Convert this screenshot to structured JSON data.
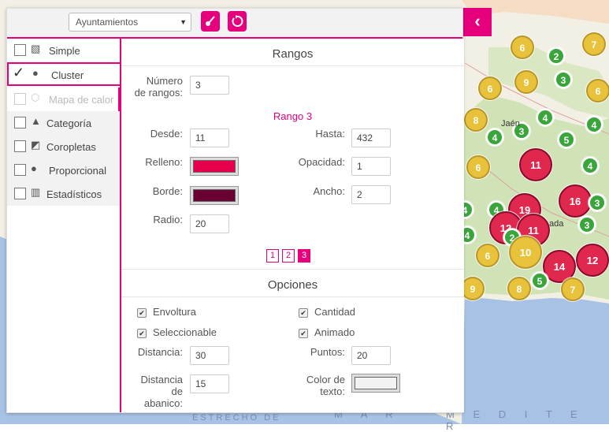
{
  "map": {
    "city_labels": [
      "Jaén",
      "ada"
    ],
    "sea_labels": [
      "ESTRECHO DE",
      "M A R",
      "M E D I T E R"
    ],
    "clusters": [
      {
        "count": "6",
        "color": "#e8c23a"
      },
      {
        "count": "7",
        "color": "#e8c23a"
      },
      {
        "count": "2",
        "color": "#3aa53a"
      },
      {
        "count": "9",
        "color": "#e8c23a"
      },
      {
        "count": "3",
        "color": "#3aa53a"
      },
      {
        "count": "6",
        "color": "#e8c23a"
      },
      {
        "count": "6",
        "color": "#e8c23a"
      },
      {
        "count": "8",
        "color": "#e8c23a"
      },
      {
        "count": "4",
        "color": "#3aa53a"
      },
      {
        "count": "3",
        "color": "#3aa53a"
      },
      {
        "count": "4",
        "color": "#3aa53a"
      },
      {
        "count": "4",
        "color": "#3aa53a"
      },
      {
        "count": "5",
        "color": "#3aa53a"
      },
      {
        "count": "6",
        "color": "#e8c23a"
      },
      {
        "count": "11",
        "color": "#e0284f"
      },
      {
        "count": "4",
        "color": "#3aa53a"
      },
      {
        "count": "16",
        "color": "#e0284f"
      },
      {
        "count": "3",
        "color": "#3aa53a"
      },
      {
        "count": "4",
        "color": "#3aa53a"
      },
      {
        "count": "19",
        "color": "#e0284f"
      },
      {
        "count": "12",
        "color": "#e0284f"
      },
      {
        "count": "11",
        "color": "#e0284f"
      },
      {
        "count": "2",
        "color": "#3aa53a"
      },
      {
        "count": "4",
        "color": "#3aa53a"
      },
      {
        "count": "3",
        "color": "#3aa53a"
      },
      {
        "count": "10",
        "color": "#e8c23a"
      },
      {
        "count": "6",
        "color": "#e8c23a"
      },
      {
        "count": "12",
        "color": "#e0284f"
      },
      {
        "count": "14",
        "color": "#e0284f"
      },
      {
        "count": "5",
        "color": "#3aa53a"
      },
      {
        "count": "9",
        "color": "#e8c23a"
      },
      {
        "count": "8",
        "color": "#e8c23a"
      },
      {
        "count": "7",
        "color": "#e8c23a"
      },
      {
        "count": "4",
        "color": "#3aa53a"
      }
    ]
  },
  "toolbar": {
    "layer_value": "Ayuntamientos",
    "style_icon": "paint-brush-icon",
    "reset_icon": "refresh-icon",
    "collapse_icon": "chevron-left-icon"
  },
  "sidebar": {
    "items": [
      {
        "label": "Simple",
        "icon": "simple-style-icon"
      },
      {
        "label": "Cluster",
        "icon": "cluster-icon"
      },
      {
        "label": "Mapa de calor",
        "icon": "heatmap-icon"
      },
      {
        "label": "Categoría",
        "icon": "category-icon"
      },
      {
        "label": "Coropletas",
        "icon": "choropleth-icon"
      },
      {
        "label": "Proporcional",
        "icon": "proportional-icon"
      },
      {
        "label": "Estadísticos",
        "icon": "statistics-icon"
      }
    ]
  },
  "rangos": {
    "title": "Rangos",
    "num_label_1": "Número",
    "num_label_2": "de rangos:",
    "num_value": "3",
    "range_title": "Rango 3",
    "desde_label": "Desde:",
    "desde_value": "11",
    "hasta_label": "Hasta:",
    "hasta_value": "432",
    "relleno_label": "Relleno:",
    "relleno_color": "#e6004c",
    "opacidad_label": "Opacidad:",
    "opacidad_value": "1",
    "borde_label": "Borde:",
    "borde_color": "#6b0035",
    "ancho_label": "Ancho:",
    "ancho_value": "2",
    "radio_label": "Radio:",
    "radio_value": "20",
    "pages": [
      "1",
      "2",
      "3"
    ]
  },
  "opciones": {
    "title": "Opciones",
    "envoltura": "Envoltura",
    "cantidad": "Cantidad",
    "seleccionable": "Seleccionable",
    "animado": "Animado",
    "distancia_label": "Distancia:",
    "distancia_value": "30",
    "puntos_label": "Puntos:",
    "puntos_value": "20",
    "dist_abanico_1": "Distancia",
    "dist_abanico_2": "de",
    "dist_abanico_3": "abanico:",
    "dist_abanico_value": "15",
    "color_texto_1": "Color de",
    "color_texto_2": "texto:",
    "color_texto_color": "#f2f2f2"
  }
}
